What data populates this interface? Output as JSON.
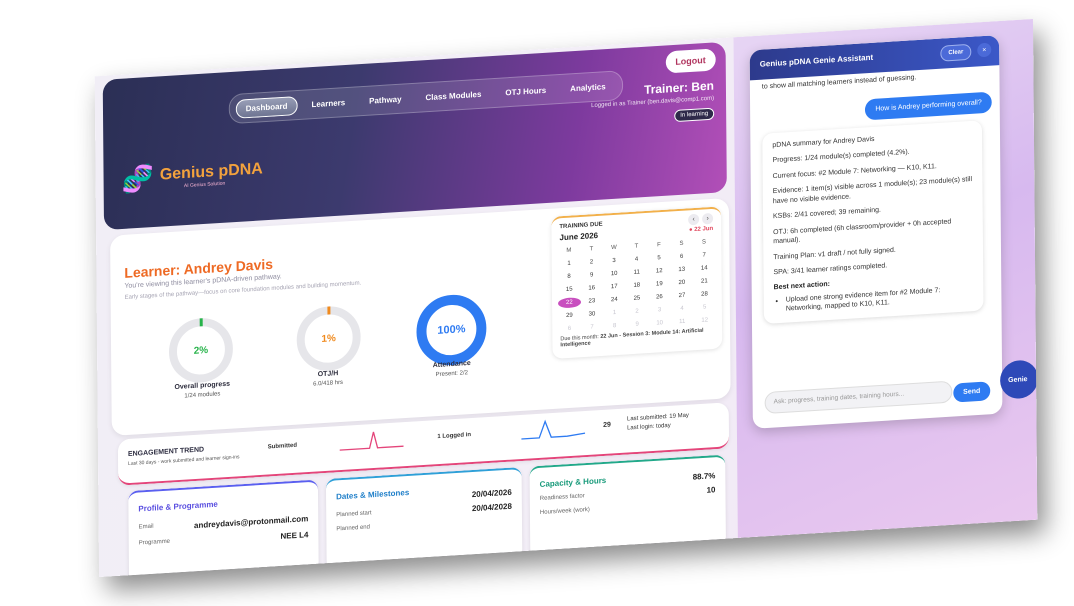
{
  "header": {
    "logout_label": "Logout",
    "nav": [
      "Dashboard",
      "Learners",
      "Pathway",
      "Class Modules",
      "OTJ Hours",
      "Analytics"
    ],
    "active_nav": "Dashboard",
    "trainer_title": "Trainer: Ben",
    "logged_in_text": "Logged in as Trainer (ben.davis@comp1.com)",
    "status_badge": "In learning",
    "logo_name": "Genius pDNA",
    "logo_sub": "AI Genius Solution"
  },
  "learner": {
    "name": "Learner: Andrey Davis",
    "intro": "You're viewing this learner's pDNA-driven pathway.",
    "subintro": "Early stages of the pathway—focus on core foundation modules and building momentum."
  },
  "metrics": {
    "overall": {
      "value": "2%",
      "label": "Overall progress",
      "sub": "1/24 modules"
    },
    "otjh": {
      "value": "1%",
      "label": "OTJ/H",
      "sub": "6.0/418 hrs"
    },
    "attendance": {
      "value": "100%",
      "label": "Attendance",
      "sub": "Present: 2/2"
    }
  },
  "calendar": {
    "heading": "TRAINING DUE",
    "month": "June 2026",
    "today_badge": "22 Jun",
    "weekdays": [
      "M",
      "T",
      "W",
      "T",
      "F",
      "S",
      "S"
    ],
    "days": [
      "1",
      "2",
      "3",
      "4",
      "5",
      "6",
      "7",
      "8",
      "9",
      "10",
      "11",
      "12",
      "13",
      "14",
      "15",
      "16",
      "17",
      "18",
      "19",
      "20",
      "21",
      "22",
      "23",
      "24",
      "25",
      "26",
      "27",
      "28",
      "29",
      "30",
      "1",
      "2",
      "3",
      "4",
      "5",
      "6",
      "7",
      "8",
      "9",
      "10",
      "11",
      "12"
    ],
    "due_prefix": "Due this month:",
    "due_text": "22 Jun - Session 3: Module 14: Artificial Intelligence"
  },
  "trend": {
    "title": "ENGAGEMENT TREND",
    "subtitle": "Last 30 days - work submitted and learner sign-ins",
    "submitted_label": "Submitted",
    "logged_in_count": "1",
    "logged_in_label": "Logged in",
    "count_right": "29",
    "last_submitted": "Last submitted: 19 May",
    "last_login": "Last login: today"
  },
  "cards": {
    "profile": {
      "title": "Profile & Programme",
      "email_label": "Email",
      "email": "andreydavis@protonmail.com",
      "programme_label": "Programme",
      "programme": "NEE L4"
    },
    "dates": {
      "title": "Dates & Milestones",
      "start_label": "Planned start",
      "start_date": "20/04/2026",
      "end_label": "Planned end",
      "end_date": "20/04/2028"
    },
    "capacity": {
      "title": "Capacity & Hours",
      "readiness_label": "Readiness factor",
      "readiness": "88.7%",
      "hours_label": "Hours/week (work)",
      "hours": "10"
    }
  },
  "assistant": {
    "title": "Genius pDNA Genie Assistant",
    "clear_label": "Clear",
    "close_label": "×",
    "prev_text": "to show all matching learners instead of guessing.",
    "user_msg": "How is Andrey performing overall?",
    "summary_title": "pDNA summary for Andrey Davis",
    "lines": [
      "Progress: 1/24 module(s) completed (4.2%).",
      "Current focus: #2 Module 7: Networking — K10, K11.",
      "Evidence: 1 item(s) visible across 1 module(s); 23 module(s) still have no visible evidence.",
      "KSBs: 2/41 covered; 39 remaining.",
      "OTJ: 6h completed (6h classroom/provider + 0h accepted manual).",
      "Training Plan: v1 draft / not fully signed.",
      "SPA: 3/41 learner ratings completed."
    ],
    "best_next_title": "Best next action:",
    "best_next": "Upload one strong evidence item for #2 Module 7: Networking, mapped to K10, K11.",
    "input_placeholder": "Ask: progress, training dates, training hours...",
    "send_label": "Send",
    "fab_label": "Genie"
  },
  "colors": {
    "accent_blue": "#2e7bf2",
    "accent_orange": "#ee6a24",
    "accent_pink": "#e4457a",
    "progress_green": "#27b34a"
  }
}
